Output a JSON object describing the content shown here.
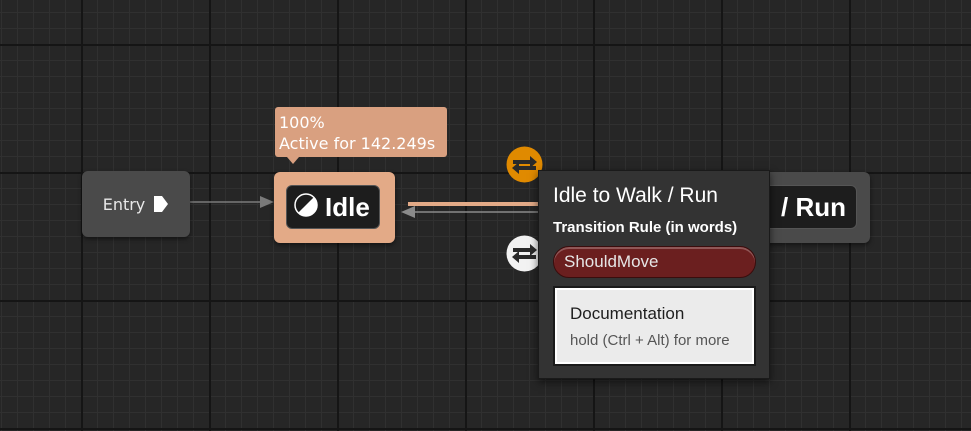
{
  "graph": {
    "entry_node": {
      "label": "Entry"
    },
    "idle_node": {
      "label": "Idle",
      "debug_weight": "100%",
      "debug_active": "Active for 142.249s"
    },
    "walkrun_node": {
      "label": "/ Run"
    }
  },
  "transition_popup": {
    "title": "Idle to Walk / Run",
    "subtitle": "Transition Rule (in words)",
    "rule": "ShouldMove",
    "doc_title": "Documentation",
    "doc_hint": "hold (Ctrl + Alt) for more"
  },
  "colors": {
    "background": "#262626",
    "idle_active": "#e3aa87",
    "active_transition": "#e08a00",
    "rule_red": "#6b1f1f"
  },
  "icons": {
    "entry": "entry-arrow-icon",
    "idle_state": "state-pie-icon",
    "active_transition": "transition-arrows-icon",
    "inactive_transition": "transition-arrows-icon"
  }
}
